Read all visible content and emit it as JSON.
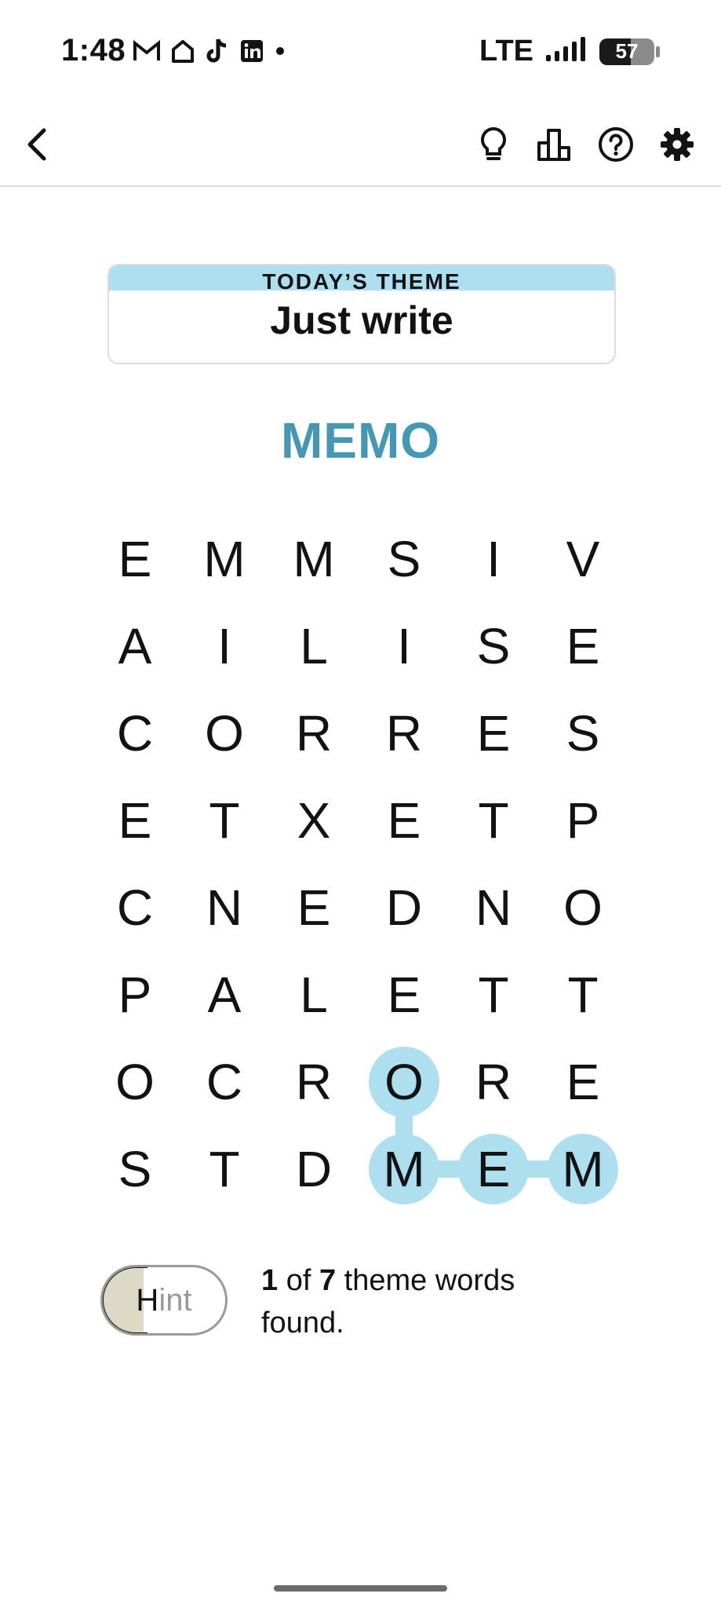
{
  "status_bar": {
    "time": "1:48",
    "network": "LTE",
    "battery": "57",
    "icons_left": [
      "gmail-icon",
      "home-icon",
      "tiktok-icon",
      "linkedin-icon",
      "dot-icon"
    ]
  },
  "toolbar": {
    "icons": [
      "back-icon",
      "hint-bulb-icon",
      "stats-icon",
      "help-icon",
      "settings-icon"
    ]
  },
  "theme": {
    "header": "TODAY’S THEME",
    "title": "Just write"
  },
  "current_word": "MEMO",
  "grid": {
    "rows": [
      [
        "E",
        "M",
        "M",
        "S",
        "I",
        "V"
      ],
      [
        "A",
        "I",
        "L",
        "I",
        "S",
        "E"
      ],
      [
        "C",
        "O",
        "R",
        "R",
        "E",
        "S"
      ],
      [
        "E",
        "T",
        "X",
        "E",
        "T",
        "P"
      ],
      [
        "C",
        "N",
        "E",
        "D",
        "N",
        "O"
      ],
      [
        "P",
        "A",
        "L",
        "E",
        "T",
        "T"
      ],
      [
        "O",
        "C",
        "R",
        "O",
        "R",
        "E"
      ],
      [
        "S",
        "T",
        "D",
        "M",
        "E",
        "M"
      ]
    ],
    "selected_path": [
      [
        7,
        5
      ],
      [
        7,
        4
      ],
      [
        7,
        3
      ],
      [
        6,
        3
      ]
    ],
    "highlight_color": "#aedfee"
  },
  "hint": {
    "label": "Hint",
    "progress": 0.3
  },
  "progress": {
    "found": "1",
    "of_word": "of",
    "total": "7",
    "suffix": "theme words",
    "line2": "found."
  },
  "colors": {
    "accent_blue": "#4598b3",
    "theme_header_bg": "#aedfee",
    "hint_fill": "#dcd9c6"
  }
}
